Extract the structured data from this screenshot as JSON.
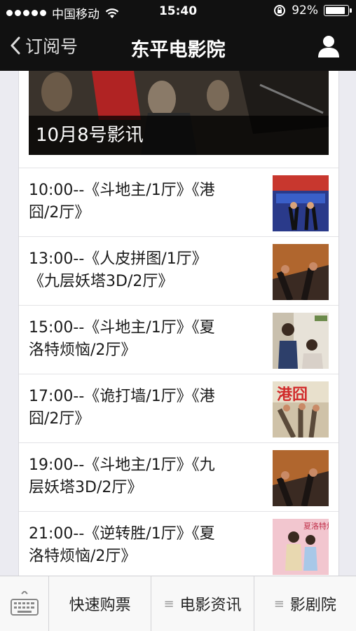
{
  "status": {
    "carrier": "中国移动",
    "time": "15:40",
    "battery_text": "92%",
    "battery_level": 0.92
  },
  "nav": {
    "back_label": "订阅号",
    "title": "东平电影院"
  },
  "hero": {
    "caption": "10月8号影讯"
  },
  "schedule": [
    {
      "line1": "10:00--《斗地主/1厅》《港",
      "line2": "囧/2厅》"
    },
    {
      "line1": "13:00--《人皮拼图/1厅》",
      "line2": "《九层妖塔3D/2厅》"
    },
    {
      "line1": "15:00--《斗地主/1厅》《夏",
      "line2": "洛特烦恼/2厅》"
    },
    {
      "line1": "17:00--《诡打墙/1厅》《港",
      "line2": "囧/2厅》"
    },
    {
      "line1": "19:00--《斗地主/1厅》《九",
      "line2": "层妖塔3D/2厅》"
    },
    {
      "line1": "21:00--《逆转胜/1厅》《夏",
      "line2": "洛特烦恼/2厅》"
    }
  ],
  "menu": {
    "item1": "快速购票",
    "item2": "电影资讯",
    "item3": "影剧院",
    "menu_glyph": "≡"
  },
  "poster_texts": {
    "p4": "港囧",
    "p6": "夏洛特烦恼"
  }
}
